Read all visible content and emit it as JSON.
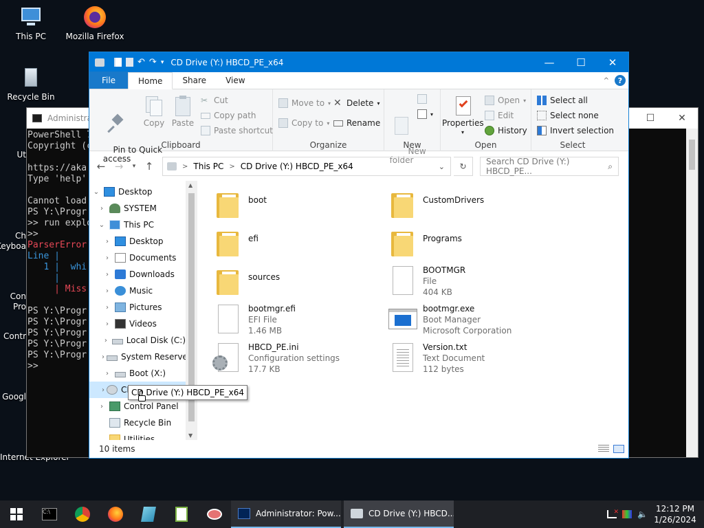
{
  "desktop": {
    "icons": [
      {
        "label": "This PC"
      },
      {
        "label": "Mozilla Firefox"
      },
      {
        "label": "Recycle Bin"
      },
      {
        "label": "Ut"
      },
      {
        "label": "Ch\nKeyboa"
      },
      {
        "label": "Con\nPro"
      },
      {
        "label": "Contr"
      },
      {
        "label": "Googl"
      },
      {
        "label": "Internet Explorer"
      }
    ]
  },
  "powershell": {
    "title": "Administrat",
    "lines": [
      {
        "text": "PowerShell 7",
        "color": "#cccccc"
      },
      {
        "text": "Copyright (c",
        "color": "#cccccc"
      },
      {
        "text": "",
        "color": "#cccccc"
      },
      {
        "text": "https://aka.",
        "color": "#cccccc"
      },
      {
        "text": "Type 'help' ",
        "color": "#cccccc"
      },
      {
        "text": "",
        "color": "#cccccc"
      },
      {
        "text": "Cannot load ",
        "color": "#cccccc"
      },
      {
        "text": "PS Y:\\Progr",
        "color": "#cccccc"
      },
      {
        "text": ">> run explo",
        "color": "#cccccc"
      },
      {
        "text": ">>",
        "color": "#cccccc"
      },
      {
        "text": "ParserError",
        "color": "#e74856"
      },
      {
        "text": "Line |",
        "color": "#3a96dd"
      },
      {
        "text": "   1 |  whi",
        "color": "#3a96dd"
      },
      {
        "text": "     |",
        "color": "#3a96dd"
      },
      {
        "text": "     | Miss",
        "color": "#e74856"
      },
      {
        "text": "",
        "color": "#cccccc"
      },
      {
        "text": "PS Y:\\Progr",
        "color": "#cccccc"
      },
      {
        "text": "PS Y:\\Progr",
        "color": "#cccccc"
      },
      {
        "text": "PS Y:\\Progr",
        "color": "#cccccc"
      },
      {
        "text": "PS Y:\\Progr",
        "color": "#cccccc"
      },
      {
        "text": "PS Y:\\Progr",
        "color": "#cccccc"
      },
      {
        "text": ">>",
        "color": "#cccccc"
      }
    ]
  },
  "explorer": {
    "title": "CD Drive (Y:) HBCD_PE_x64",
    "tabs": {
      "file": "File",
      "home": "Home",
      "share": "Share",
      "view": "View"
    },
    "ribbon": {
      "clipboard": {
        "label": "Clipboard",
        "pin": "Pin to Quick\naccess",
        "copy": "Copy",
        "paste": "Paste",
        "cut": "Cut",
        "copy_path": "Copy path",
        "paste_shortcut": "Paste shortcut"
      },
      "organize": {
        "label": "Organize",
        "move_to": "Move to",
        "copy_to": "Copy to",
        "delete": "Delete",
        "rename": "Rename"
      },
      "new": {
        "label": "New",
        "new_folder": "New\nfolder"
      },
      "open": {
        "label": "Open",
        "properties": "Properties",
        "open": "Open",
        "edit": "Edit",
        "history": "History"
      },
      "select": {
        "label": "Select",
        "select_all": "Select all",
        "select_none": "Select none",
        "invert": "Invert selection"
      }
    },
    "address": {
      "crumbs": [
        "This PC",
        "CD Drive (Y:) HBCD_PE_x64"
      ],
      "search_placeholder": "Search CD Drive (Y:) HBCD_PE..."
    },
    "nav": [
      {
        "label": "Desktop",
        "level": 0,
        "chev": "v",
        "icon": "desktop"
      },
      {
        "label": "SYSTEM",
        "level": 1,
        "chev": ">",
        "icon": "user"
      },
      {
        "label": "This PC",
        "level": 1,
        "chev": "v",
        "icon": "pc"
      },
      {
        "label": "Desktop",
        "level": 2,
        "chev": ">",
        "icon": "desktop"
      },
      {
        "label": "Documents",
        "level": 2,
        "chev": ">",
        "icon": "documents"
      },
      {
        "label": "Downloads",
        "level": 2,
        "chev": ">",
        "icon": "downloads"
      },
      {
        "label": "Music",
        "level": 2,
        "chev": ">",
        "icon": "music"
      },
      {
        "label": "Pictures",
        "level": 2,
        "chev": ">",
        "icon": "pictures"
      },
      {
        "label": "Videos",
        "level": 2,
        "chev": ">",
        "icon": "videos"
      },
      {
        "label": "Local Disk (C:)",
        "level": 2,
        "chev": ">",
        "icon": "drive"
      },
      {
        "label": "System Reserve",
        "level": 2,
        "chev": ">",
        "icon": "drive"
      },
      {
        "label": "Boot (X:)",
        "level": 2,
        "chev": ">",
        "icon": "drive"
      },
      {
        "label": "CD Drive (Y:) HBCD_PE_x64",
        "level": 2,
        "chev": ">",
        "icon": "cd"
      },
      {
        "label": "Control Panel",
        "level": 1,
        "chev": ">",
        "icon": "control"
      },
      {
        "label": "Recycle Bin",
        "level": 1,
        "chev": "",
        "icon": "recycle"
      },
      {
        "label": "Utilities",
        "level": 1,
        "chev": "",
        "icon": "folder"
      }
    ],
    "tooltip": "CD Drive (Y:) HBCD_PE_x64",
    "files": [
      {
        "name": "boot",
        "sub1": "",
        "sub2": "",
        "icon": "folder"
      },
      {
        "name": "CustomDrivers",
        "sub1": "",
        "sub2": "",
        "icon": "folder"
      },
      {
        "name": "efi",
        "sub1": "",
        "sub2": "",
        "icon": "folder"
      },
      {
        "name": "Programs",
        "sub1": "",
        "sub2": "",
        "icon": "folder"
      },
      {
        "name": "sources",
        "sub1": "",
        "sub2": "",
        "icon": "folder"
      },
      {
        "name": "BOOTMGR",
        "sub1": "File",
        "sub2": "404 KB",
        "icon": "doc"
      },
      {
        "name": "bootmgr.efi",
        "sub1": "EFI File",
        "sub2": "1.46 MB",
        "icon": "doc"
      },
      {
        "name": "bootmgr.exe",
        "sub1": "Boot Manager",
        "sub2": "Microsoft Corporation",
        "icon": "exe"
      },
      {
        "name": "HBCD_PE.ini",
        "sub1": "Configuration settings",
        "sub2": "17.7 KB",
        "icon": "ini"
      },
      {
        "name": "Version.txt",
        "sub1": "Text Document",
        "sub2": "112 bytes",
        "icon": "txt"
      }
    ],
    "status": "10 items"
  },
  "taskbar": {
    "apps": [
      {
        "label": "Administrator: Pow...",
        "state": "open"
      },
      {
        "label": "CD Drive (Y:) HBCD...",
        "state": "active"
      }
    ],
    "time": "12:12 PM",
    "date": "1/26/2024"
  }
}
